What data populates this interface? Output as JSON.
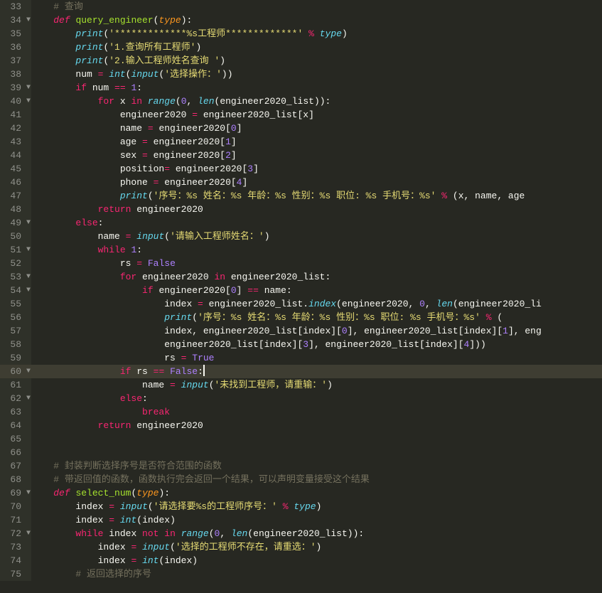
{
  "startLine": 33,
  "currentLine": 60,
  "foldLines": [
    34,
    39,
    40,
    49,
    51,
    53,
    54,
    60,
    62,
    69,
    72
  ],
  "code": [
    [
      [
        "    ",
        ""
      ],
      [
        "# 查询",
        "cm"
      ]
    ],
    [
      [
        "    ",
        ""
      ],
      [
        "def",
        "kw-i"
      ],
      [
        " ",
        "id"
      ],
      [
        "query_engineer",
        "fn"
      ],
      [
        "(",
        "pn"
      ],
      [
        "type",
        "param"
      ],
      [
        "):",
        "pn"
      ]
    ],
    [
      [
        "        ",
        ""
      ],
      [
        "print",
        "type"
      ],
      [
        "(",
        "pn"
      ],
      [
        "'*************%s工程师*************'",
        "str"
      ],
      [
        " ",
        "id"
      ],
      [
        "%",
        "op"
      ],
      [
        " ",
        "id"
      ],
      [
        "type",
        "type"
      ],
      [
        ")",
        "pn"
      ]
    ],
    [
      [
        "        ",
        ""
      ],
      [
        "print",
        "type"
      ],
      [
        "(",
        "pn"
      ],
      [
        "'1.查询所有工程师'",
        "str"
      ],
      [
        ")",
        "pn"
      ]
    ],
    [
      [
        "        ",
        ""
      ],
      [
        "print",
        "type"
      ],
      [
        "(",
        "pn"
      ],
      [
        "'2.输入工程师姓名查询 '",
        "str"
      ],
      [
        ")",
        "pn"
      ]
    ],
    [
      [
        "        ",
        ""
      ],
      [
        "num ",
        "id"
      ],
      [
        "=",
        "op"
      ],
      [
        " ",
        "id"
      ],
      [
        "int",
        "type"
      ],
      [
        "(",
        "pn"
      ],
      [
        "input",
        "type"
      ],
      [
        "(",
        "pn"
      ],
      [
        "'选择操作：'",
        "str"
      ],
      [
        "))",
        "pn"
      ]
    ],
    [
      [
        "        ",
        ""
      ],
      [
        "if",
        "kw"
      ],
      [
        " num ",
        "id"
      ],
      [
        "==",
        "op"
      ],
      [
        " ",
        "id"
      ],
      [
        "1",
        "num"
      ],
      [
        ":",
        "pn"
      ]
    ],
    [
      [
        "            ",
        ""
      ],
      [
        "for",
        "kw"
      ],
      [
        " x ",
        "id"
      ],
      [
        "in",
        "kw"
      ],
      [
        " ",
        "id"
      ],
      [
        "range",
        "type"
      ],
      [
        "(",
        "pn"
      ],
      [
        "0",
        "num"
      ],
      [
        ", ",
        "pn"
      ],
      [
        "len",
        "type"
      ],
      [
        "(engineer2020_list)):",
        "pn"
      ]
    ],
    [
      [
        "                ",
        ""
      ],
      [
        "engineer2020 ",
        "id"
      ],
      [
        "=",
        "op"
      ],
      [
        " engineer2020_list[x]",
        "id"
      ]
    ],
    [
      [
        "                ",
        ""
      ],
      [
        "name ",
        "id"
      ],
      [
        "=",
        "op"
      ],
      [
        " engineer2020[",
        "id"
      ],
      [
        "0",
        "num"
      ],
      [
        "]",
        "pn"
      ]
    ],
    [
      [
        "                ",
        ""
      ],
      [
        "age ",
        "id"
      ],
      [
        "=",
        "op"
      ],
      [
        " engineer2020[",
        "id"
      ],
      [
        "1",
        "num"
      ],
      [
        "]",
        "pn"
      ]
    ],
    [
      [
        "                ",
        ""
      ],
      [
        "sex ",
        "id"
      ],
      [
        "=",
        "op"
      ],
      [
        " engineer2020[",
        "id"
      ],
      [
        "2",
        "num"
      ],
      [
        "]",
        "pn"
      ]
    ],
    [
      [
        "                ",
        ""
      ],
      [
        "position",
        "id"
      ],
      [
        "=",
        "op"
      ],
      [
        " engineer2020[",
        "id"
      ],
      [
        "3",
        "num"
      ],
      [
        "]",
        "pn"
      ]
    ],
    [
      [
        "                ",
        ""
      ],
      [
        "phone ",
        "id"
      ],
      [
        "=",
        "op"
      ],
      [
        " engineer2020[",
        "id"
      ],
      [
        "4",
        "num"
      ],
      [
        "]",
        "pn"
      ]
    ],
    [
      [
        "                ",
        ""
      ],
      [
        "print",
        "type"
      ],
      [
        "(",
        "pn"
      ],
      [
        "'序号：%s 姓名：%s 年龄：%s 性别：%s 职位: %s 手机号：%s'",
        "str"
      ],
      [
        " ",
        "id"
      ],
      [
        "%",
        "op"
      ],
      [
        " (x, name, age",
        "id"
      ]
    ],
    [
      [
        "            ",
        ""
      ],
      [
        "return",
        "kw"
      ],
      [
        " engineer2020",
        "id"
      ]
    ],
    [
      [
        "        ",
        ""
      ],
      [
        "else",
        "kw"
      ],
      [
        ":",
        "pn"
      ]
    ],
    [
      [
        "            ",
        ""
      ],
      [
        "name ",
        "id"
      ],
      [
        "=",
        "op"
      ],
      [
        " ",
        "id"
      ],
      [
        "input",
        "type"
      ],
      [
        "(",
        "pn"
      ],
      [
        "'请输入工程师姓名：'",
        "str"
      ],
      [
        ")",
        "pn"
      ]
    ],
    [
      [
        "            ",
        ""
      ],
      [
        "while",
        "kw"
      ],
      [
        " ",
        "id"
      ],
      [
        "1",
        "num"
      ],
      [
        ":",
        "pn"
      ]
    ],
    [
      [
        "                ",
        ""
      ],
      [
        "rs ",
        "id"
      ],
      [
        "=",
        "op"
      ],
      [
        " ",
        "id"
      ],
      [
        "False",
        "num"
      ]
    ],
    [
      [
        "                ",
        ""
      ],
      [
        "for",
        "kw"
      ],
      [
        " engineer2020 ",
        "id"
      ],
      [
        "in",
        "kw"
      ],
      [
        " engineer2020_list:",
        "id"
      ]
    ],
    [
      [
        "                    ",
        ""
      ],
      [
        "if",
        "kw"
      ],
      [
        " engineer2020[",
        "id"
      ],
      [
        "0",
        "num"
      ],
      [
        "] ",
        "pn"
      ],
      [
        "==",
        "op"
      ],
      [
        " name:",
        "id"
      ]
    ],
    [
      [
        "                        ",
        ""
      ],
      [
        "index ",
        "id"
      ],
      [
        "=",
        "op"
      ],
      [
        " engineer2020_list.",
        "id"
      ],
      [
        "index",
        "type"
      ],
      [
        "(engineer2020, ",
        "pn"
      ],
      [
        "0",
        "num"
      ],
      [
        ", ",
        "pn"
      ],
      [
        "len",
        "type"
      ],
      [
        "(engineer2020_li",
        "pn"
      ]
    ],
    [
      [
        "                        ",
        ""
      ],
      [
        "print",
        "type"
      ],
      [
        "(",
        "pn"
      ],
      [
        "'序号：%s 姓名：%s 年龄：%s 性别：%s 职位: %s 手机号：%s'",
        "str"
      ],
      [
        " ",
        "id"
      ],
      [
        "%",
        "op"
      ],
      [
        " (",
        "pn"
      ]
    ],
    [
      [
        "                        ",
        ""
      ],
      [
        "index, engineer2020_list[index][",
        "id"
      ],
      [
        "0",
        "num"
      ],
      [
        "], engineer2020_list[index][",
        "id"
      ],
      [
        "1",
        "num"
      ],
      [
        "], eng",
        "id"
      ]
    ],
    [
      [
        "                        ",
        ""
      ],
      [
        "engineer2020_list[index][",
        "id"
      ],
      [
        "3",
        "num"
      ],
      [
        "], engineer2020_list[index][",
        "id"
      ],
      [
        "4",
        "num"
      ],
      [
        "]))",
        "pn"
      ]
    ],
    [
      [
        "                        ",
        ""
      ],
      [
        "rs ",
        "id"
      ],
      [
        "=",
        "op"
      ],
      [
        " ",
        "id"
      ],
      [
        "True",
        "num"
      ]
    ],
    [
      [
        "                ",
        ""
      ],
      [
        "if",
        "kw"
      ],
      [
        " rs ",
        "id"
      ],
      [
        "==",
        "op"
      ],
      [
        " ",
        "id"
      ],
      [
        "False",
        "num"
      ],
      [
        ":",
        "pn"
      ],
      [
        "CURSOR",
        ""
      ]
    ],
    [
      [
        "                    ",
        ""
      ],
      [
        "name ",
        "id"
      ],
      [
        "=",
        "op"
      ],
      [
        " ",
        "id"
      ],
      [
        "input",
        "type"
      ],
      [
        "(",
        "pn"
      ],
      [
        "'未找到工程师，请重输：'",
        "str"
      ],
      [
        ")",
        "pn"
      ]
    ],
    [
      [
        "                ",
        ""
      ],
      [
        "else",
        "kw"
      ],
      [
        ":",
        "pn"
      ]
    ],
    [
      [
        "                    ",
        ""
      ],
      [
        "break",
        "kw"
      ]
    ],
    [
      [
        "            ",
        ""
      ],
      [
        "return",
        "kw"
      ],
      [
        " engineer2020",
        "id"
      ]
    ],
    [
      [
        "",
        ""
      ]
    ],
    [
      [
        "",
        ""
      ]
    ],
    [
      [
        "    ",
        ""
      ],
      [
        "# 封装判断选择序号是否符合范围的函数",
        "cm"
      ]
    ],
    [
      [
        "    ",
        ""
      ],
      [
        "# 带返回值的函数，函数执行完会返回一个结果，可以声明变量接受这个结果",
        "cm"
      ]
    ],
    [
      [
        "    ",
        ""
      ],
      [
        "def",
        "kw-i"
      ],
      [
        " ",
        "id"
      ],
      [
        "select_num",
        "fn"
      ],
      [
        "(",
        "pn"
      ],
      [
        "type",
        "param"
      ],
      [
        "):",
        "pn"
      ]
    ],
    [
      [
        "        ",
        ""
      ],
      [
        "index ",
        "id"
      ],
      [
        "=",
        "op"
      ],
      [
        " ",
        "id"
      ],
      [
        "input",
        "type"
      ],
      [
        "(",
        "pn"
      ],
      [
        "'请选择要%s的工程师序号：'",
        "str"
      ],
      [
        " ",
        "id"
      ],
      [
        "%",
        "op"
      ],
      [
        " ",
        "id"
      ],
      [
        "type",
        "type"
      ],
      [
        ")",
        "pn"
      ]
    ],
    [
      [
        "        ",
        ""
      ],
      [
        "index ",
        "id"
      ],
      [
        "=",
        "op"
      ],
      [
        " ",
        "id"
      ],
      [
        "int",
        "type"
      ],
      [
        "(index)",
        "pn"
      ]
    ],
    [
      [
        "        ",
        ""
      ],
      [
        "while",
        "kw"
      ],
      [
        " index ",
        "id"
      ],
      [
        "not",
        "kw"
      ],
      [
        " ",
        "id"
      ],
      [
        "in",
        "kw"
      ],
      [
        " ",
        "id"
      ],
      [
        "range",
        "type"
      ],
      [
        "(",
        "pn"
      ],
      [
        "0",
        "num"
      ],
      [
        ", ",
        "pn"
      ],
      [
        "len",
        "type"
      ],
      [
        "(engineer2020_list)):",
        "pn"
      ]
    ],
    [
      [
        "            ",
        ""
      ],
      [
        "index ",
        "id"
      ],
      [
        "=",
        "op"
      ],
      [
        " ",
        "id"
      ],
      [
        "input",
        "type"
      ],
      [
        "(",
        "pn"
      ],
      [
        "'选择的工程师不存在，请重选：'",
        "str"
      ],
      [
        ")",
        "pn"
      ]
    ],
    [
      [
        "            ",
        ""
      ],
      [
        "index ",
        "id"
      ],
      [
        "=",
        "op"
      ],
      [
        " ",
        "id"
      ],
      [
        "int",
        "type"
      ],
      [
        "(index)",
        "pn"
      ]
    ],
    [
      [
        "        ",
        ""
      ],
      [
        "# 返回选择的序号",
        "cm"
      ]
    ]
  ]
}
